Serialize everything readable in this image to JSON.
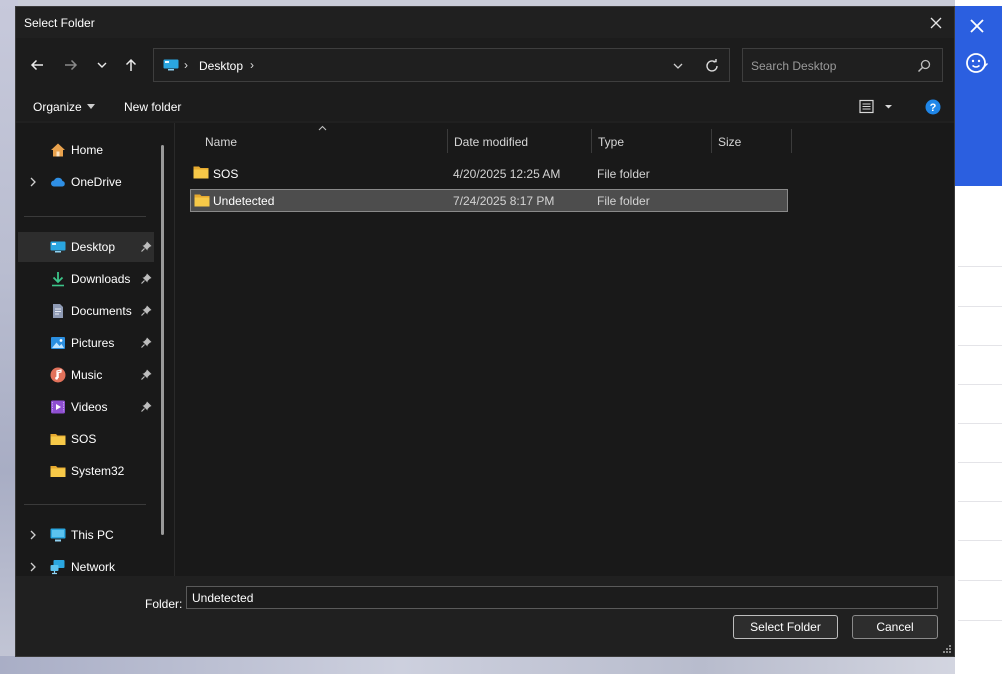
{
  "dialog": {
    "title": "Select Folder"
  },
  "address": {
    "location": "Desktop",
    "separator": "›"
  },
  "search": {
    "placeholder": "Search Desktop"
  },
  "toolbar": {
    "organize_label": "Organize",
    "new_folder_label": "New folder"
  },
  "sidebar": {
    "items": [
      {
        "label": "Home",
        "icon": "home-icon"
      },
      {
        "label": "OneDrive",
        "icon": "cloud-icon",
        "expandable": true
      },
      {
        "label": "Desktop",
        "icon": "desktop-icon",
        "pinned": true,
        "selected": true
      },
      {
        "label": "Downloads",
        "icon": "download-icon",
        "pinned": true
      },
      {
        "label": "Documents",
        "icon": "document-icon",
        "pinned": true
      },
      {
        "label": "Pictures",
        "icon": "picture-icon",
        "pinned": true
      },
      {
        "label": "Music",
        "icon": "music-icon",
        "pinned": true
      },
      {
        "label": "Videos",
        "icon": "video-icon",
        "pinned": true
      },
      {
        "label": "SOS",
        "icon": "folder-icon"
      },
      {
        "label": "System32",
        "icon": "folder-icon"
      },
      {
        "label": "This PC",
        "icon": "computer-icon",
        "expandable": true
      },
      {
        "label": "Network",
        "icon": "network-icon",
        "expandable": true
      }
    ]
  },
  "columns": {
    "name": "Name",
    "date_modified": "Date modified",
    "type": "Type",
    "size": "Size"
  },
  "files": [
    {
      "name": "SOS",
      "date_modified": "4/20/2025 12:25 AM",
      "type": "File folder",
      "selected": false
    },
    {
      "name": "Undetected",
      "date_modified": "7/24/2025 8:17 PM",
      "type": "File folder",
      "selected": true
    }
  ],
  "footer": {
    "folder_label": "Folder:",
    "folder_value": "Undetected",
    "select_button": "Select Folder",
    "cancel_button": "Cancel"
  },
  "colors": {
    "dialog_bg": "#202020",
    "pane_bg": "#191919",
    "selection_bg": "#4d4d4d",
    "accent_blue": "#2b5fe0",
    "folder_yellow": "#f4c342"
  }
}
